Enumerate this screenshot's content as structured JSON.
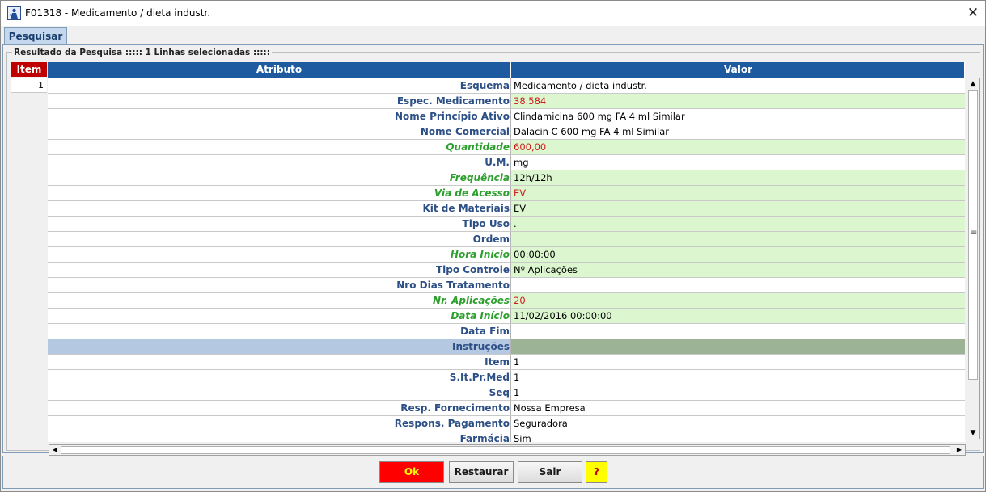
{
  "window": {
    "title": "F01318 - Medicamento / dieta industr.",
    "close_symbol": "✕"
  },
  "tabs": [
    {
      "label": "Pesquisar"
    }
  ],
  "results": {
    "legend": "Resultado da Pesquisa ::::: 1 Linhas selecionadas :::::"
  },
  "table": {
    "item_header": "Item",
    "item_value": "1",
    "columns": [
      "Atributo",
      "Valor"
    ],
    "rows": [
      {
        "attr": "Esquema",
        "value": "Medicamento / dieta industr.",
        "style": ""
      },
      {
        "attr": "Espec. Medicamento",
        "value": "38.584",
        "style": "shade red"
      },
      {
        "attr": "Nome Princípio Ativo",
        "value": "Clindamicina   600 mg  FA  4 ml   Similar",
        "style": ""
      },
      {
        "attr": "Nome Comercial",
        "value": "Dalacin C  600 mg  FA  4 ml   Similar",
        "style": ""
      },
      {
        "attr": "Quantidade",
        "value": "600,00",
        "style": "italic shade red"
      },
      {
        "attr": "U.M.",
        "value": "mg",
        "style": ""
      },
      {
        "attr": "Frequência",
        "value": "12h/12h",
        "style": "italic shade"
      },
      {
        "attr": "Via de Acesso",
        "value": "EV",
        "style": "italic shade red"
      },
      {
        "attr": "Kit de Materiais",
        "value": "EV",
        "style": "shade"
      },
      {
        "attr": "Tipo Uso",
        "value": ".",
        "style": "shade"
      },
      {
        "attr": "Ordem",
        "value": "",
        "style": "shade"
      },
      {
        "attr": "Hora Início",
        "value": "00:00:00",
        "style": "italic shade"
      },
      {
        "attr": "Tipo Controle",
        "value": "Nº Aplicações",
        "style": "shade"
      },
      {
        "attr": "Nro Dias Tratamento",
        "value": "",
        "style": ""
      },
      {
        "attr": "Nr. Aplicações",
        "value": "20",
        "style": "italic shade red"
      },
      {
        "attr": "Data Início",
        "value": "11/02/2016 00:00:00",
        "style": "italic shade"
      },
      {
        "attr": "Data Fim",
        "value": "",
        "style": ""
      },
      {
        "attr": "Instruções",
        "value": "",
        "style": "section"
      },
      {
        "attr": "Item",
        "value": "1",
        "style": ""
      },
      {
        "attr": "S.It.Pr.Med",
        "value": "1",
        "style": ""
      },
      {
        "attr": "Seq",
        "value": "1",
        "style": ""
      },
      {
        "attr": "Resp. Fornecimento",
        "value": "Nossa Empresa",
        "style": ""
      },
      {
        "attr": "Respons. Pagamento",
        "value": "Seguradora",
        "style": ""
      },
      {
        "attr": "Farmácia",
        "value": "Sim",
        "style": ""
      }
    ]
  },
  "buttons": {
    "ok": "Ok",
    "restaurar": "Restaurar",
    "sair": "Sair",
    "help": "?"
  },
  "colors": {
    "header_blue": "#1e5aa0",
    "row_green": "#dcf7d0",
    "ok_red": "#ff0000",
    "help_yellow": "#ffff00"
  }
}
